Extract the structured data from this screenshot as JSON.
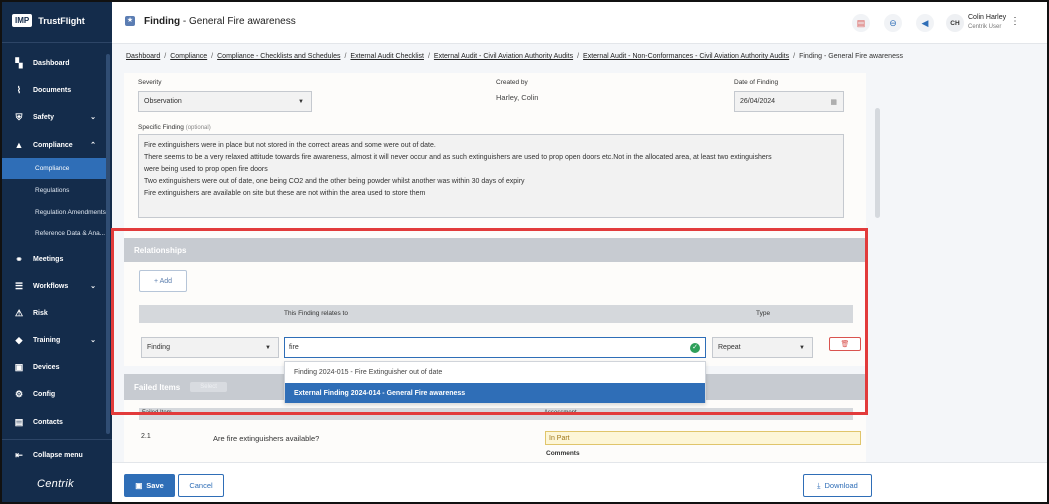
{
  "app": {
    "logo_box": "IMP",
    "logo_text": "TrustFlight",
    "footer_brand": "Centrik"
  },
  "sidebar": {
    "items": [
      {
        "label": "Dashboard",
        "icon": "dashboard-icon"
      },
      {
        "label": "Documents",
        "icon": "paperclip-icon"
      },
      {
        "label": "Safety",
        "icon": "shield-icon"
      },
      {
        "label": "Compliance",
        "icon": "graduation-icon"
      },
      {
        "label": "Meetings",
        "icon": "meetings-icon"
      },
      {
        "label": "Workflows",
        "icon": "workflow-icon"
      },
      {
        "label": "Risk",
        "icon": "warning-icon"
      },
      {
        "label": "Training",
        "icon": "training-icon"
      },
      {
        "label": "Devices",
        "icon": "devices-icon"
      },
      {
        "label": "Config",
        "icon": "config-icon"
      },
      {
        "label": "Contacts",
        "icon": "contacts-icon"
      }
    ],
    "sub_items": [
      "Compliance",
      "Regulations",
      "Regulation Amendments",
      "Reference Data & Ana..."
    ],
    "collapse_label": "Collapse menu"
  },
  "header": {
    "title_prefix": "Finding",
    "title_suffix": "- General Fire awareness",
    "user_initials": "CH",
    "user_name": "Colin Harley",
    "user_role": "Centrik User"
  },
  "breadcrumb": {
    "links": [
      "Dashboard",
      "Compliance",
      "Compliance - Checklists and Schedules",
      "External Audit Checklist",
      "External Audit - Civil Aviation Authority Audits",
      "External Audit - Non-Conformances - Civil Aviation Authority Audits"
    ],
    "current": "Finding - General Fire awareness"
  },
  "form": {
    "severity_label": "Severity",
    "severity_value": "Observation",
    "created_by_label": "Created by",
    "created_by_value": "Harley, Colin",
    "date_label": "Date of Finding",
    "date_value": "26/04/2024",
    "specific_label": "Specific Finding",
    "specific_optional": "(optional)",
    "specific_lines": [
      "Fire extinguishers were in place but not stored in the correct areas and some were out of date.",
      "There seems to be a very relaxed attitude towards fire awareness, almost it will never occur and as such extinguishers are used to prop open doors etc.Not in the allocated area, at least two extinguishers",
      "were being used to prop open fire doors",
      "Two extinguishers were out of date, one being CO2 and the other being powder whilst another was within 30 days of expiry",
      "Fire extinguishers are available on site but these are not within the area used to store them"
    ]
  },
  "relationships": {
    "heading": "Relationships",
    "add_label": "+ Add",
    "col_relates": "This Finding relates to",
    "col_type": "Type",
    "row_kind": "Finding",
    "search_value": "fire",
    "row_type": "Repeat",
    "options": [
      "Finding 2024-015 - Fire Extinguisher out of date",
      "External Finding 2024-014 - General Fire awareness"
    ]
  },
  "failed_items": {
    "heading": "Failed Items",
    "select_label": "Select",
    "col_item": "Failed Item",
    "col_assessment": "Assessment",
    "row_num": "2.1",
    "row_question": "Are fire extinguishers available?",
    "row_assessment": "In Part",
    "comments_label": "Comments"
  },
  "footer": {
    "save_label": "Save",
    "cancel_label": "Cancel",
    "download_label": "Download"
  },
  "colors": {
    "sidebar_bg": "#142c4b",
    "primary": "#2f6eb7",
    "highlight": "#e23b3b",
    "danger": "#d9534f"
  }
}
